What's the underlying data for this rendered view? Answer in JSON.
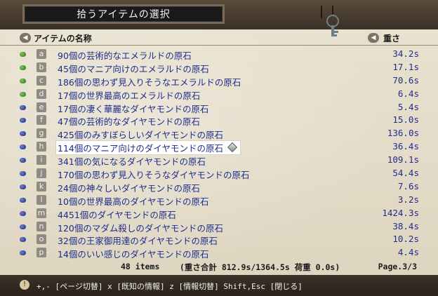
{
  "window": {
    "title": "拾うアイテムの選択"
  },
  "header": {
    "name_column": "アイテムの名称",
    "weight_column": "重さ"
  },
  "items": [
    {
      "letter": "a",
      "name": "90個の芸術的なエメラルドの原石",
      "weight": "34.2s",
      "bullet": "green"
    },
    {
      "letter": "b",
      "name": "45個のマニア向けのエメラルドの原石",
      "weight": "17.1s",
      "bullet": "green"
    },
    {
      "letter": "c",
      "name": "186個の思わず見入りそうなエメラルドの原石",
      "weight": "70.6s",
      "bullet": "green"
    },
    {
      "letter": "d",
      "name": "17個の世界最高のエメラルドの原石",
      "weight": "6.4s",
      "bullet": "green"
    },
    {
      "letter": "e",
      "name": "17個の凄く華麗なダイヤモンドの原石",
      "weight": "5.4s",
      "bullet": "blue"
    },
    {
      "letter": "f",
      "name": "47個の芸術的なダイヤモンドの原石",
      "weight": "15.0s",
      "bullet": "blue"
    },
    {
      "letter": "g",
      "name": "425個のみすぼらしいダイヤモンドの原石",
      "weight": "136.0s",
      "bullet": "blue"
    },
    {
      "letter": "h",
      "name": "114個のマニア向けのダイヤモンドの原石",
      "weight": "36.4s",
      "bullet": "blue",
      "selected": true
    },
    {
      "letter": "i",
      "name": "341個の気になるダイヤモンドの原石",
      "weight": "109.1s",
      "bullet": "blue"
    },
    {
      "letter": "j",
      "name": "170個の思わず見入りそうなダイヤモンドの原石",
      "weight": "54.4s",
      "bullet": "blue"
    },
    {
      "letter": "k",
      "name": "24個の神々しいダイヤモンドの原石",
      "weight": "7.6s",
      "bullet": "blue"
    },
    {
      "letter": "l",
      "name": "10個の世界最高のダイヤモンドの原石",
      "weight": "3.2s",
      "bullet": "blue"
    },
    {
      "letter": "m",
      "name": "4451個のダイヤモンドの原石",
      "weight": "1424.3s",
      "bullet": "blue"
    },
    {
      "letter": "n",
      "name": "120個のマダム殺しのダイヤモンドの原石",
      "weight": "38.4s",
      "bullet": "blue"
    },
    {
      "letter": "o",
      "name": "32個の王家御用達のダイヤモンドの原石",
      "weight": "10.2s",
      "bullet": "blue"
    },
    {
      "letter": "p",
      "name": "14個のいい感じのダイヤモンドの原石",
      "weight": "4.4s",
      "bullet": "blue"
    }
  ],
  "summary": {
    "items": "48 items",
    "weight_total": "(重さ合計 812.9s/1364.5s  荷重 0.0s)",
    "page": "Page.3/3"
  },
  "footer": {
    "hint_badge": "!",
    "hint": "+,- [ページ切替]  x [既知の情報]  z [情報切替]  Shift,Esc [閉じる]"
  },
  "colors": {
    "bullet_green": "#2f6e1b",
    "bullet_blue": "#1f2a7a",
    "text_blue": "#1e2d8c"
  }
}
